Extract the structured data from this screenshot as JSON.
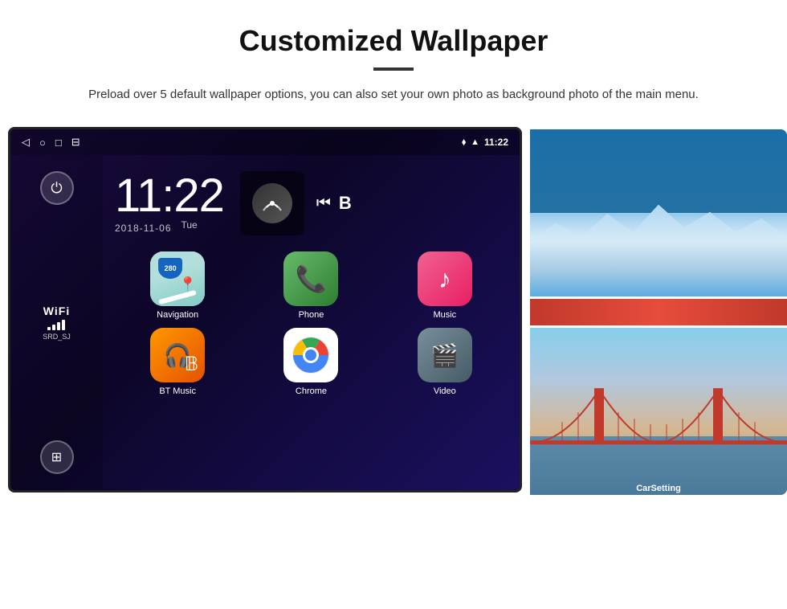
{
  "header": {
    "title": "Customized Wallpaper",
    "divider": "",
    "description": "Preload over 5 default wallpaper options, you can also set your own photo as background photo of the main menu."
  },
  "statusBar": {
    "time": "11:22",
    "navBack": "◁",
    "navHome": "○",
    "navRecent": "□",
    "navScreenshot": "⊟",
    "locationIcon": "📍",
    "wifiIcon": "▲",
    "batteryIcon": "▌"
  },
  "sidebar": {
    "powerLabel": "⏻",
    "wifiLabel": "WiFi",
    "wifiSSID": "SRD_SJ",
    "appsGridLabel": "⊞"
  },
  "clock": {
    "time": "11:22",
    "date": "2018-11-06",
    "day": "Tue"
  },
  "mediaControls": {
    "prev": "⏮",
    "next": "B"
  },
  "apps": [
    {
      "name": "Navigation",
      "type": "nav"
    },
    {
      "name": "Phone",
      "type": "phone"
    },
    {
      "name": "Music",
      "type": "music"
    },
    {
      "name": "BT Music",
      "type": "bt"
    },
    {
      "name": "Chrome",
      "type": "chrome"
    },
    {
      "name": "Video",
      "type": "video"
    }
  ],
  "wallpapers": {
    "topAlt": "Ice cave wallpaper",
    "bottomAlt": "Golden Gate Bridge wallpaper",
    "carSettingLabel": "CarSetting"
  }
}
